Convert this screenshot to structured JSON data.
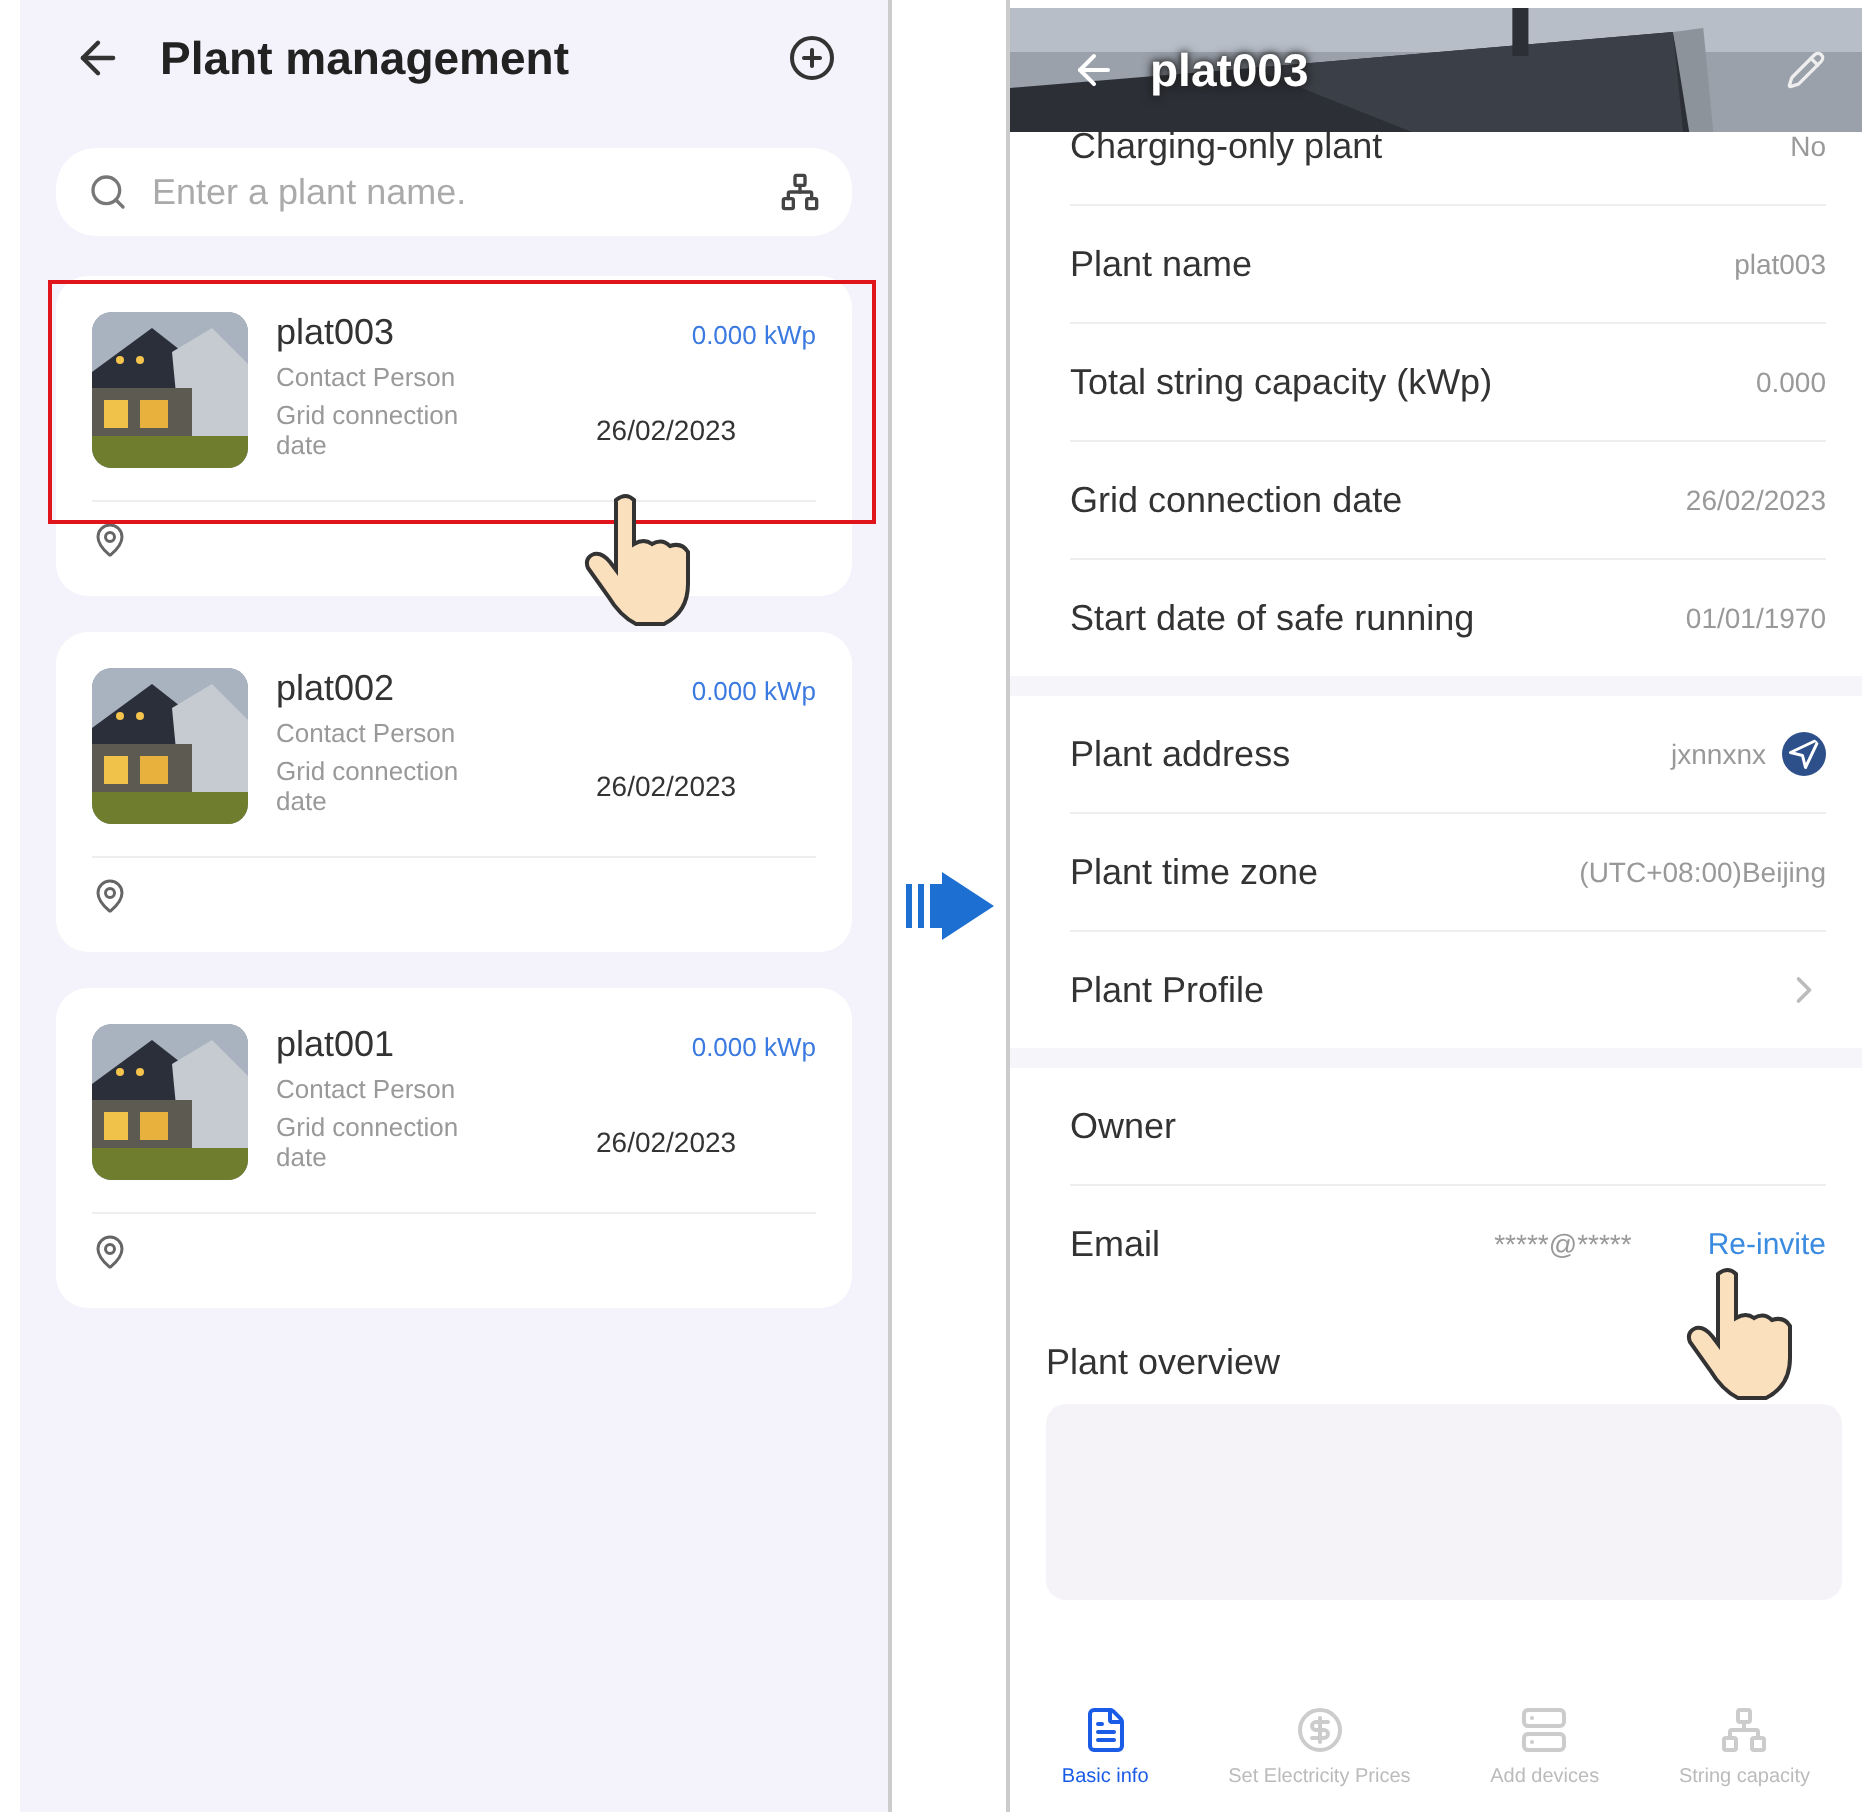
{
  "left_screen": {
    "title": "Plant management",
    "search": {
      "placeholder": "Enter a plant name."
    },
    "plants": [
      {
        "name": "plat003",
        "capacity": "0.000 kWp",
        "contact_label": "Contact Person",
        "grid_label": "Grid connection date",
        "grid_date": "26/02/2023",
        "highlighted": true,
        "tapped": true
      },
      {
        "name": "plat002",
        "capacity": "0.000 kWp",
        "contact_label": "Contact Person",
        "grid_label": "Grid connection date",
        "grid_date": "26/02/2023",
        "highlighted": false,
        "tapped": false
      },
      {
        "name": "plat001",
        "capacity": "0.000 kWp",
        "contact_label": "Contact Person",
        "grid_label": "Grid connection date",
        "grid_date": "26/02/2023",
        "highlighted": false,
        "tapped": false
      }
    ]
  },
  "right_screen": {
    "title": "plat003",
    "sections": [
      [
        {
          "kind": "value",
          "label": "Charging-only plant",
          "value": "No"
        },
        {
          "kind": "value",
          "label": "Plant name",
          "value": "plat003"
        },
        {
          "kind": "value",
          "label": "Total string capacity (kWp)",
          "value": "0.000"
        },
        {
          "kind": "value",
          "label": "Grid connection date",
          "value": "26/02/2023"
        },
        {
          "kind": "value",
          "label": "Start date of safe running",
          "value": "01/01/1970"
        }
      ],
      [
        {
          "kind": "address",
          "label": "Plant address",
          "value": "jxnnxnx"
        },
        {
          "kind": "value",
          "label": "Plant time zone",
          "value": "(UTC+08:00)Beijing"
        },
        {
          "kind": "link",
          "label": "Plant Profile"
        }
      ],
      [
        {
          "kind": "label",
          "label": "Owner"
        },
        {
          "kind": "email",
          "label": "Email",
          "value": "*****@*****",
          "action": "Re-invite",
          "tapped": true
        }
      ]
    ],
    "overview": {
      "title": "Plant overview"
    },
    "tabs": [
      {
        "label": "Basic info",
        "selected": true
      },
      {
        "label": "Set Electricity Prices",
        "selected": false
      },
      {
        "label": "Add devices",
        "selected": false
      },
      {
        "label": "String capacity",
        "selected": false
      }
    ]
  }
}
